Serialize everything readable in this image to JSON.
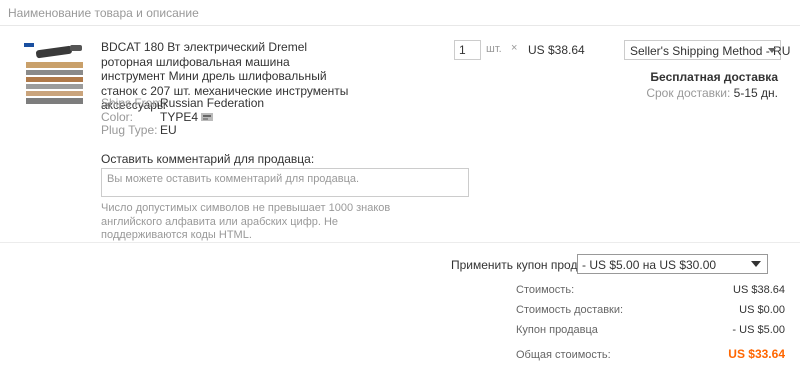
{
  "header": {
    "title": "Наименование товара и описание"
  },
  "product": {
    "image_icon": "product-thumbnail",
    "title": "BDCAT 180 Вт электрический Dremel роторная шлифовальная машина инструмент Мини дрель шлифовальный станок с 207 шт. механические инструменты аксессуары",
    "attributes": [
      {
        "key": "Ships From:",
        "value": "Russian Federation"
      },
      {
        "key": "Color:",
        "value": "TYPE4"
      },
      {
        "key": "Plug Type:",
        "value": "EU"
      }
    ]
  },
  "quantity": {
    "value": "1",
    "unit": "шт.",
    "times": "×",
    "unit_price": "US $38.64"
  },
  "shipping": {
    "method": "Seller's Shipping Method - RU",
    "free": "Бесплатная доставка",
    "delivery_label": "Срок доставки:",
    "delivery_value": "5-15 дн."
  },
  "comment": {
    "label": "Оставить комментарий для продавца:",
    "placeholder": "Вы можете оставить комментарий для продавца.",
    "hint": "Число допустимых символов не превышает 1000 знаков английского алфавита или арабских цифр. Не поддерживаются коды HTML."
  },
  "coupon": {
    "label": "Применить купон продавца",
    "selected": "- US $5.00 на US $30.00"
  },
  "summary": {
    "cost_label": "Стоимость:",
    "cost_value": "US $38.64",
    "shipping_label": "Стоимость доставки:",
    "shipping_value": "US $0.00",
    "coupon_label": "Купон продавца",
    "coupon_value": "- US $5.00",
    "total_label": "Общая стоимость:",
    "total_value": "US $33.64"
  },
  "colors": {
    "accent_total": "#ff6600",
    "muted": "#999999"
  }
}
